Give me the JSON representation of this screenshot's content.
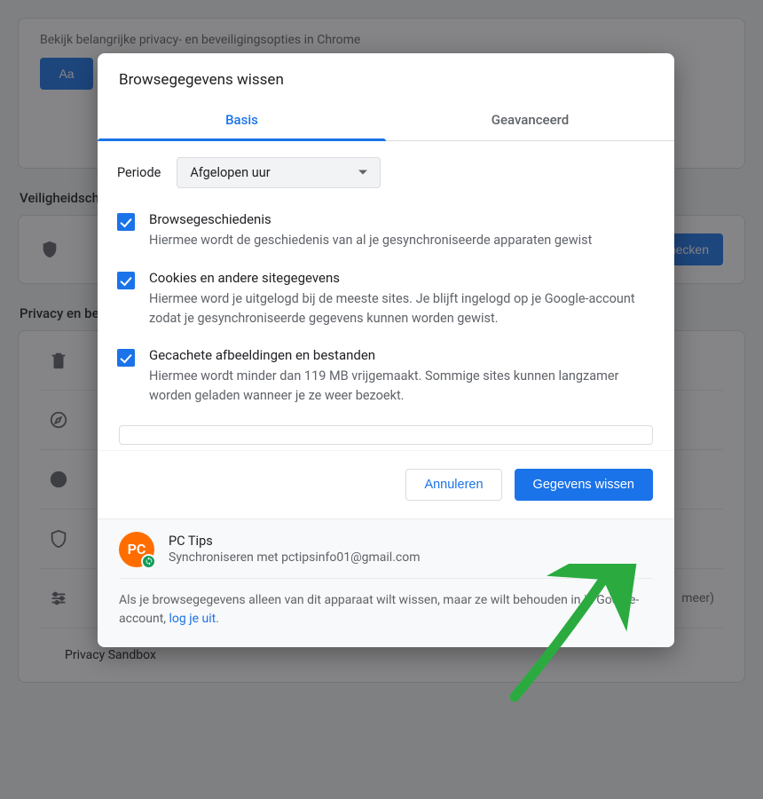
{
  "bg": {
    "guide_text": "Bekijk belangrijke privacy- en beveiligingsopties in Chrome",
    "guide_button": "Aa",
    "section_security": "Veiligheidscheck",
    "check_button": "Nu checken",
    "section_privacy": "Privacy en beveiliging",
    "more_text": "meer)",
    "sandbox": "Privacy Sandbox"
  },
  "dialog": {
    "title": "Browsegegevens wissen",
    "tabs": {
      "basic": "Basis",
      "advanced": "Geavanceerd"
    },
    "period_label": "Periode",
    "period_value": "Afgelopen uur",
    "options": [
      {
        "title": "Browsegeschiedenis",
        "desc": "Hiermee wordt de geschiedenis van al je gesynchroniseerde apparaten gewist"
      },
      {
        "title": "Cookies en andere sitegegevens",
        "desc": "Hiermee word je uitgelogd bij de meeste sites. Je blijft ingelogd op je Google-account zodat je gesynchroniseerde gegevens kunnen worden gewist."
      },
      {
        "title": "Gecachete afbeeldingen en bestanden",
        "desc": "Hiermee wordt minder dan 119 MB vrijgemaakt. Sommige sites kunnen langzamer worden geladen wanneer je ze weer bezoekt."
      }
    ],
    "cancel": "Annuleren",
    "confirm": "Gegevens wissen",
    "account": {
      "initials": "PC",
      "name": "PC Tips",
      "sync": "Synchroniseren met pctipsinfo01@gmail.com"
    },
    "footnote_1": "Als je browsegegevens alleen van dit apparaat wilt wissen, maar ze wilt behouden in je Google-account, ",
    "footnote_link": "log je uit",
    "footnote_2": "."
  }
}
